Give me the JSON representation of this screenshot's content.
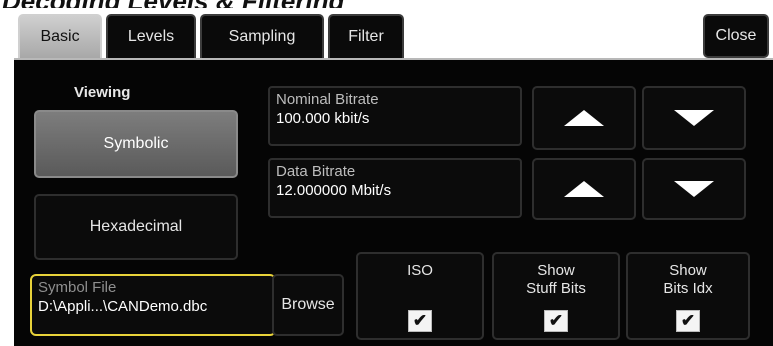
{
  "title": "Decoding Levels & Filtering",
  "tabs": [
    {
      "label": "Basic",
      "active": true
    },
    {
      "label": "Levels",
      "active": false
    },
    {
      "label": "Sampling",
      "active": false
    },
    {
      "label": "Filter",
      "active": false
    }
  ],
  "close_label": "Close",
  "viewing": {
    "label": "Viewing",
    "options": [
      "Symbolic",
      "Hexadecimal"
    ],
    "selected": "Symbolic"
  },
  "nominal_bitrate": {
    "caption": "Nominal Bitrate",
    "value": "100.000 kbit/s"
  },
  "data_bitrate": {
    "caption": "Data Bitrate",
    "value": "12.000000 Mbit/s"
  },
  "symbol_file": {
    "caption": "Symbol File",
    "value": "D:\\Appli...\\CANDemo.dbc"
  },
  "browse_label": "Browse",
  "checkboxes": [
    {
      "label_1": "ISO",
      "label_2": "",
      "checked": true
    },
    {
      "label_1": "Show",
      "label_2": "Stuff Bits",
      "checked": true
    },
    {
      "label_1": "Show",
      "label_2": "Bits Idx",
      "checked": true
    }
  ],
  "icons": {
    "increase": "up-arrow-icon",
    "decrease": "down-arrow-icon",
    "check": "checkmark-icon"
  },
  "colors": {
    "panel_bg": "#050505",
    "active_tab": "#c0c0c0",
    "selected_button": "#6e6e6e",
    "focus_border": "#e8d23a"
  }
}
